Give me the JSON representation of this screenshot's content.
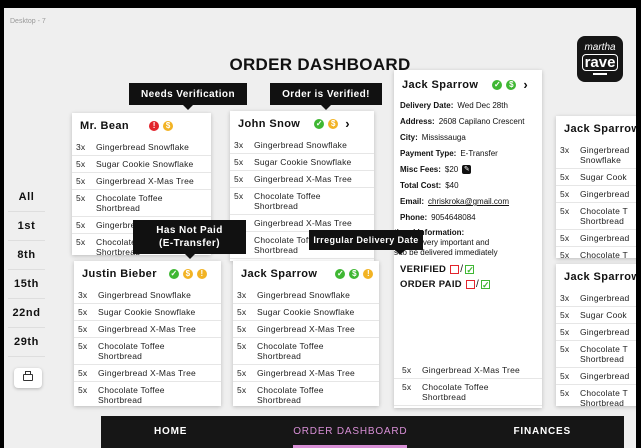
{
  "frame_label": "Desktop - 7",
  "page_title": "ORDER DASHBOARD",
  "logo": {
    "line1": "martha",
    "line2": "rave"
  },
  "day_filters": [
    "All",
    "1st",
    "8th",
    "15th",
    "22nd",
    "29th"
  ],
  "tooltips": {
    "needs_verification": "Needs Verification",
    "order_verified": "Order is Verified!",
    "not_paid_line1": "Has Not Paid",
    "not_paid_line2": "(E-Transfer)",
    "irregular_delivery": "Irregular Delivery Date"
  },
  "cards": {
    "bean": {
      "name": "Mr. Bean",
      "items": [
        {
          "qty": "3x",
          "name": "Gingerbread Snowflake"
        },
        {
          "qty": "5x",
          "name": "Sugar Cookie Snowflake"
        },
        {
          "qty": "5x",
          "name": "Gingerbread X-Mas Tree"
        },
        {
          "qty": "5x",
          "name": "Chocolate Toffee\nShortbread"
        },
        {
          "qty": "5x",
          "name": "Gingerbread X-Mas Tree"
        },
        {
          "qty": "5x",
          "name": "Chocolate Toffee\nShortbread"
        }
      ]
    },
    "snow": {
      "name": "John Snow",
      "items": [
        {
          "qty": "3x",
          "name": "Gingerbread Snowflake"
        },
        {
          "qty": "5x",
          "name": "Sugar Cookie Snowflake"
        },
        {
          "qty": "5x",
          "name": "Gingerbread X-Mas Tree"
        },
        {
          "qty": "5x",
          "name": "Chocolate Toffee\nShortbread"
        },
        {
          "qty": "5x",
          "name": "Gingerbread X-Mas Tree"
        },
        {
          "qty": "5x",
          "name": "Chocolate Toffee\nShortbread"
        }
      ]
    },
    "bieber": {
      "name": "Justin Bieber",
      "items": [
        {
          "qty": "3x",
          "name": "Gingerbread Snowflake"
        },
        {
          "qty": "5x",
          "name": "Sugar Cookie Snowflake"
        },
        {
          "qty": "5x",
          "name": "Gingerbread X-Mas Tree"
        },
        {
          "qty": "5x",
          "name": "Chocolate Toffee\nShortbread"
        },
        {
          "qty": "5x",
          "name": "Gingerbread X-Mas Tree"
        },
        {
          "qty": "5x",
          "name": "Chocolate Toffee\nShortbread"
        }
      ]
    },
    "sparrow_mid": {
      "name": "Jack Sparrow",
      "items": [
        {
          "qty": "3x",
          "name": "Gingerbread Snowflake"
        },
        {
          "qty": "5x",
          "name": "Sugar Cookie Snowflake"
        },
        {
          "qty": "5x",
          "name": "Gingerbread X-Mas Tree"
        },
        {
          "qty": "5x",
          "name": "Chocolate Toffee\nShortbread"
        },
        {
          "qty": "5x",
          "name": "Gingerbread X-Mas Tree"
        },
        {
          "qty": "5x",
          "name": "Chocolate Toffee\nShortbread"
        }
      ]
    },
    "sparrow_detail": {
      "name": "Jack Sparrow",
      "fields": [
        {
          "label": "Delivery Date:",
          "value": "Wed Dec 28th"
        },
        {
          "label": "Address:",
          "value": "2608 Capilano Crescent"
        },
        {
          "label": "City:",
          "value": "Mississauga"
        },
        {
          "label": "Payment Type:",
          "value": "E-Transfer"
        },
        {
          "label": "Misc Fees:",
          "value": "$20"
        },
        {
          "label": "Total Cost:",
          "value": "$40"
        },
        {
          "label": "Email:",
          "value": "chriskroka@gmail.com"
        },
        {
          "label": "Phone:",
          "value": "9054648084"
        }
      ],
      "notes_label": "tional Information:",
      "notes_line1": "order is very important and",
      "notes_line2": "s to be delivered immediately",
      "verified_label": "VERIFIED",
      "paid_label": "ORDER PAID",
      "items": [
        {
          "qty": "5x",
          "name": "Gingerbread X-Mas Tree"
        },
        {
          "qty": "5x",
          "name": "Chocolate Toffee\nShortbread"
        }
      ]
    },
    "sparrow_right_top": {
      "name": "Jack Sparrow",
      "items": [
        {
          "qty": "3x",
          "name": "Gingerbread Snowflake"
        },
        {
          "qty": "5x",
          "name": "Sugar Cook"
        },
        {
          "qty": "5x",
          "name": "Gingerbread"
        },
        {
          "qty": "5x",
          "name": "Chocolate T\nShortbread"
        },
        {
          "qty": "5x",
          "name": "Gingerbread"
        },
        {
          "qty": "5x",
          "name": "Chocolate T\nShortbread"
        }
      ]
    },
    "sparrow_right_bottom": {
      "name": "Jack Sparrow",
      "items": [
        {
          "qty": "3x",
          "name": "Gingerbread"
        },
        {
          "qty": "5x",
          "name": "Sugar Cook"
        },
        {
          "qty": "5x",
          "name": "Gingerbread"
        },
        {
          "qty": "5x",
          "name": "Chocolate T\nShortbread"
        },
        {
          "qty": "5x",
          "name": "Gingerbread"
        },
        {
          "qty": "5x",
          "name": "Chocolate T\nShortbread"
        }
      ]
    }
  },
  "nav": {
    "home": "HOME",
    "dashboard": "ORDER DASHBOARD",
    "finances": "FINANCES"
  },
  "colors": {
    "accent": "#d88fd6",
    "verified": "#3fb733",
    "unpaid": "#f2b324",
    "alert": "#e2242c"
  }
}
